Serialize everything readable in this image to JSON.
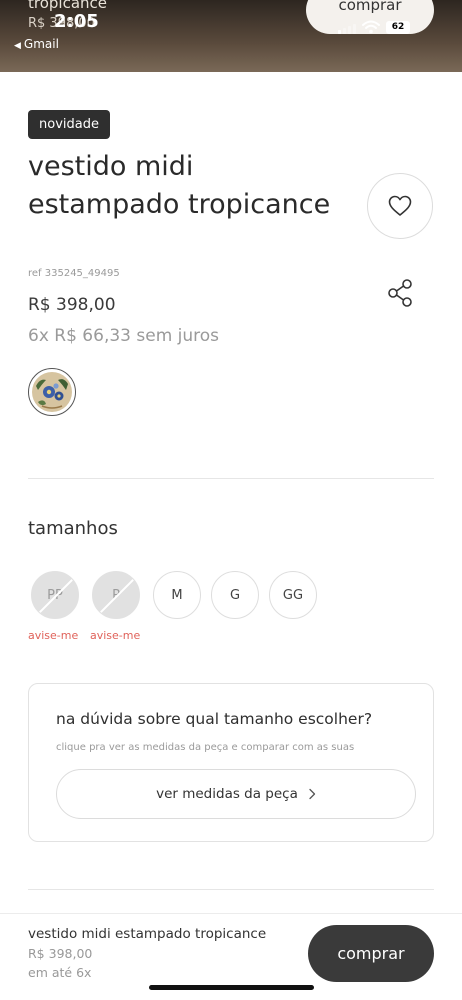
{
  "status_bar": {
    "time": "2:05",
    "back_app": "Gmail",
    "battery": "62"
  },
  "background_header": {
    "title": "tropicance",
    "price": "R$ 398,00",
    "buy_label": "comprar"
  },
  "product": {
    "badge": "novidade",
    "title": "vestido midi estampado tropicance",
    "ref": "ref 335245_49495",
    "price": "R$ 398,00",
    "installments": "6x R$ 66,33 sem juros",
    "color_swatch": "tropicance-print",
    "icons": {
      "favorite": "heart-icon",
      "share": "share-icon"
    }
  },
  "sizes": {
    "heading": "tamanhos",
    "options": [
      {
        "label": "PP",
        "available": false,
        "notify": "avise-me"
      },
      {
        "label": "P",
        "available": false,
        "notify": "avise-me"
      },
      {
        "label": "M",
        "available": true
      },
      {
        "label": "G",
        "available": true
      },
      {
        "label": "GG",
        "available": true
      }
    ]
  },
  "size_guide": {
    "title": "na dúvida sobre qual tamanho escolher?",
    "subtitle": "clique pra ver as medidas da peça e comparar com as suas",
    "button": "ver medidas da peça"
  },
  "bottom_bar": {
    "product_name": "vestido midi estampado tropicance",
    "price": "R$ 398,00",
    "installments": "em até 6x",
    "buy_button": "comprar"
  },
  "colors": {
    "badge_bg": "#2f2f2f",
    "buy_button_bg": "#3a3a3a",
    "notify_text": "#e0625a",
    "unavailable_size_bg": "#e1e1e1"
  }
}
